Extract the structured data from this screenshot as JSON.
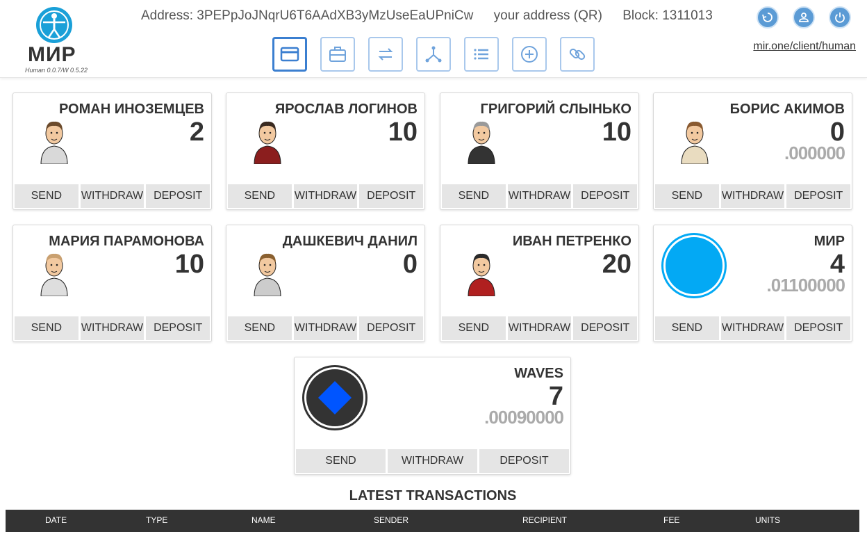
{
  "header": {
    "logo_word": "МИР",
    "version": "Human 0.0.7/W 0.5.22",
    "address": "Address: 3PEPpJoJNqrU6T6AAdXB3yMzUseEaUPniCw",
    "qr_label": "your address (QR)",
    "block": "Block: 1311013",
    "site_link": "mir.one/client/human"
  },
  "nav": [
    "card-icon",
    "briefcase-icon",
    "transfer-icon",
    "network-icon",
    "list-icon",
    "add-circle-icon",
    "link-icon"
  ],
  "round_buttons": [
    "refresh-icon",
    "user-icon",
    "power-icon"
  ],
  "actions": {
    "send": "SEND",
    "withdraw": "WITHDRAW",
    "deposit": "DEPOSIT"
  },
  "cards": [
    {
      "name": "РОМАН ИНОЗЕМЦЕВ",
      "amount": "2",
      "fraction": ""
    },
    {
      "name": "ЯРОСЛАВ ЛОГИНОВ",
      "amount": "10",
      "fraction": ""
    },
    {
      "name": "ГРИГОРИЙ СЛЫНЬКО",
      "amount": "10",
      "fraction": ""
    },
    {
      "name": "БОРИС АКИМОВ",
      "amount": "0",
      "fraction": ".000000"
    },
    {
      "name": "МАРИЯ ПАРАМОНОВА",
      "amount": "10",
      "fraction": ""
    },
    {
      "name": "ДАШКЕВИЧ ДАНИЛ",
      "amount": "0",
      "fraction": ""
    },
    {
      "name": "ИВАН ПЕТРЕНКО",
      "amount": "20",
      "fraction": ""
    },
    {
      "name": "МИР",
      "amount": "4",
      "fraction": ".01100000"
    },
    {
      "name": "WAVES",
      "amount": "7",
      "fraction": ".00090000"
    }
  ],
  "transactions": {
    "title": "LATEST TRANSACTIONS",
    "columns": [
      "DATE",
      "TYPE",
      "NAME",
      "SENDER",
      "RECIPIENT",
      "FEE",
      "UNITS"
    ]
  },
  "colors": {
    "accent": "#5b9bd5",
    "mir_coin": "#03a9f4",
    "waves_coin": "#0055ff",
    "table_header": "#333333"
  }
}
